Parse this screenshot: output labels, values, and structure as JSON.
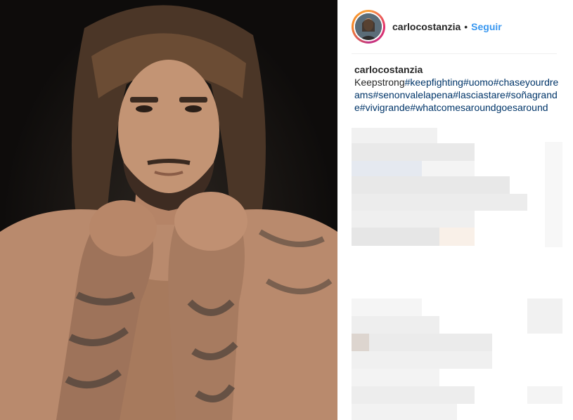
{
  "post": {
    "username": "carlocostanzia",
    "separator": "•",
    "follow_label": "Seguir"
  },
  "caption": {
    "username": "carlocostanzia",
    "text": "Keepstrong",
    "hashtags": [
      "#keepfighting",
      "#uomo",
      "#chaseyourdreams",
      "#senonvalelapena",
      "#lasciastare",
      "#soñagrande",
      "#vivigrande",
      "#whatcomesaroundgoesaround"
    ]
  },
  "colors": {
    "link": "#3897f0",
    "hashtag": "#003569",
    "text": "#262626"
  },
  "icons": {
    "avatar": "profile-photo",
    "photo": "shirtless-man-tattooed-fists"
  }
}
